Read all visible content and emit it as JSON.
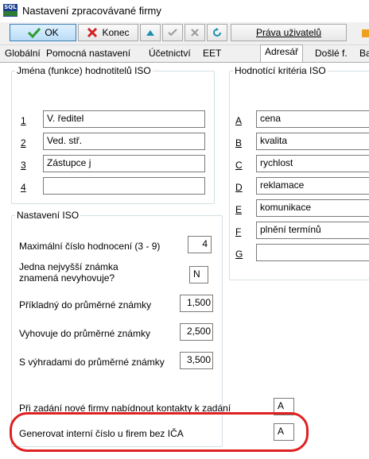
{
  "window": {
    "title": "Nastavení zpracovávané firmy",
    "icon_text": "SQL"
  },
  "toolbar": {
    "ok_label": "OK",
    "konec_label": "Konec",
    "prava_label": "Práva uživatelů"
  },
  "tabs": [
    {
      "label": "Globální"
    },
    {
      "label": "Pomocná nastavení"
    },
    {
      "label": "Účetnictví"
    },
    {
      "label": "EET"
    },
    {
      "label": "Adresář"
    },
    {
      "label": "Došlé f."
    },
    {
      "label": "Ba"
    }
  ],
  "names_group": {
    "title": "Jména (funkce) hodnotitelů ISO",
    "rows": [
      {
        "num": "1",
        "value": "V. ředitel"
      },
      {
        "num": "2",
        "value": "Ved. stř."
      },
      {
        "num": "3",
        "value": "Zástupce j"
      },
      {
        "num": "4",
        "value": ""
      }
    ]
  },
  "criteria_group": {
    "title": "Hodnotící kritéria ISO",
    "rows": [
      {
        "letter": "A",
        "value": "cena"
      },
      {
        "letter": "B",
        "value": "kvalita"
      },
      {
        "letter": "C",
        "value": "rychlost"
      },
      {
        "letter": "D",
        "value": "reklamace"
      },
      {
        "letter": "E",
        "value": "komunikace"
      },
      {
        "letter": "F",
        "value": "plnění termínů"
      },
      {
        "letter": "G",
        "value": ""
      }
    ]
  },
  "iso_group": {
    "title": "Nastavení ISO",
    "max_label": "Maximální číslo hodnocení (3 - 9)",
    "max_value": "4",
    "best_label_1": "Jedna nejvyšší známka",
    "best_label_2": "znamená nevyhovuje?",
    "best_value": "N",
    "ex_label": "Příkladný do průměrné známky",
    "ex_value": "1,500",
    "ok_label": "Vyhovuje do průměrné známky",
    "ok_value": "2,500",
    "res_label": "S výhradami do průměrné známky",
    "res_value": "3,500"
  },
  "bottom": {
    "contacts_label": "Při zadání nové firmy nabídnout kontakty k zadání",
    "contacts_value": "A",
    "internal_label": "Generovat interní číslo u firem bez IČA",
    "internal_value": "A"
  },
  "colors": {
    "highlight": "#e02020",
    "ok_check": "#2e9b2e",
    "close_x": "#d42020"
  }
}
